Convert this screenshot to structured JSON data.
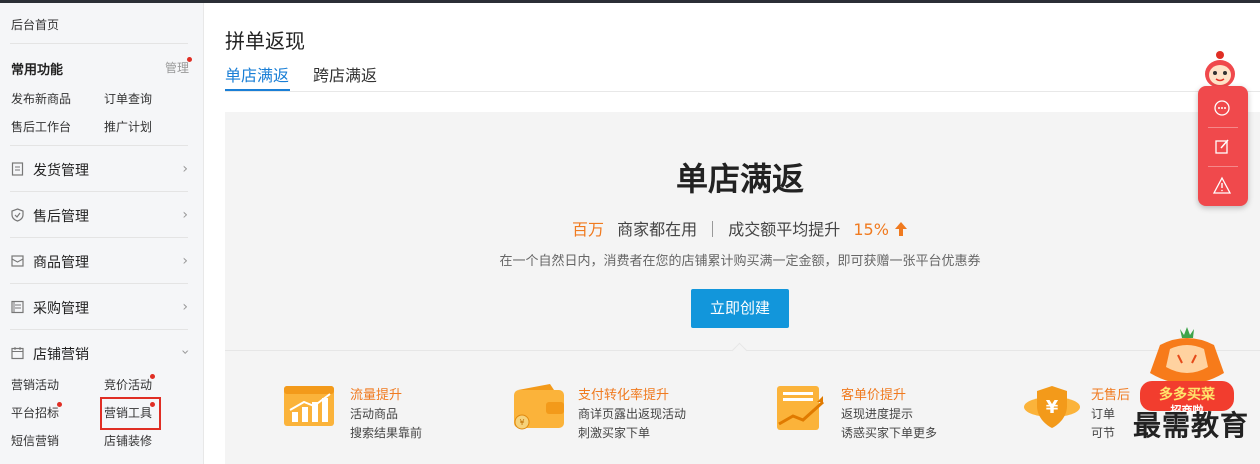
{
  "sidebar": {
    "home": "后台首页",
    "favorites": {
      "title": "常用功能",
      "manage": "管理",
      "links": [
        "发布新商品",
        "订单查询",
        "售后工作台",
        "推广计划"
      ]
    },
    "sections": [
      {
        "label": "发货管理",
        "icon": "document-icon"
      },
      {
        "label": "售后管理",
        "icon": "shield-check-icon"
      },
      {
        "label": "商品管理",
        "icon": "box-icon"
      },
      {
        "label": "采购管理",
        "icon": "list-icon"
      },
      {
        "label": "店铺营销",
        "icon": "calendar-icon"
      }
    ],
    "marketing_links": [
      "营销活动",
      "竞价活动",
      "平台招标",
      "营销工具",
      "短信营销",
      "店铺装修"
    ]
  },
  "main": {
    "title": "拼单返现",
    "tabs": [
      {
        "label": "单店满返",
        "active": true
      },
      {
        "label": "跨店满返",
        "active": false
      }
    ],
    "hero": {
      "title": "单店满返",
      "sub_num1": "百万",
      "sub_text1": "商家都在用",
      "sub_text2": "成交额平均提升",
      "sub_num2": "15%",
      "desc": "在一个自然日内，消费者在您的店铺累计购买满一定金额，即可获赠一张平台优惠券",
      "cta": "立即创建"
    },
    "features": [
      {
        "title": "流量提升",
        "line1": "活动商品",
        "line2": "搜索结果靠前",
        "icon": "chart-up-icon"
      },
      {
        "title": "支付转化率提升",
        "line1": "商详页露出返现活动",
        "line2": "刺激买家下单",
        "icon": "wallet-icon"
      },
      {
        "title": "客单价提升",
        "line1": "返现进度提示",
        "line2": "诱惑买家下单更多",
        "icon": "rising-bars-icon"
      },
      {
        "title": "无售后",
        "line1": "订单",
        "line2": "可节",
        "icon": "yen-shield-icon"
      }
    ]
  },
  "float_widget": {
    "buttons": [
      "chat-bubble-icon",
      "edit-icon",
      "warning-icon"
    ]
  },
  "watermark": {
    "badge_text": "多多买菜",
    "badge_sub": "招商啦",
    "text": "最需教育"
  },
  "colors": {
    "accent_blue": "#1a7fd6",
    "cta_blue": "#1296db",
    "orange": "#f07a1f",
    "float_red": "#f0494c",
    "badge_red": "#e02e24"
  }
}
